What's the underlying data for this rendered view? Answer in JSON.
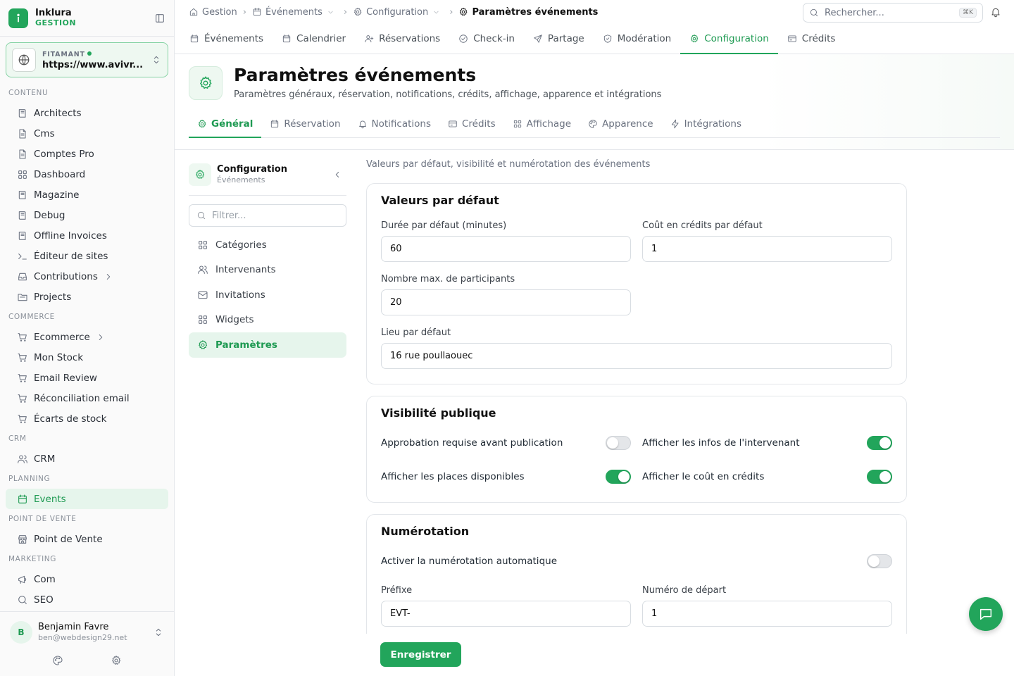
{
  "brand": {
    "name": "Inklura",
    "sub": "GESTION"
  },
  "site": {
    "label": "FITAMANT",
    "url": "https://www.avivr..."
  },
  "sidebar": {
    "sections": [
      {
        "title": "CONTENU",
        "items": [
          {
            "label": "Architects",
            "icon": "book-icon"
          },
          {
            "label": "Cms",
            "icon": "file-icon"
          },
          {
            "label": "Comptes Pro",
            "icon": "file-icon"
          },
          {
            "label": "Dashboard",
            "icon": "grid-icon"
          },
          {
            "label": "Magazine",
            "icon": "book-icon"
          },
          {
            "label": "Debug",
            "icon": "book-icon"
          },
          {
            "label": "Offline Invoices",
            "icon": "book-icon"
          },
          {
            "label": "Éditeur de sites",
            "icon": "terminal-icon"
          },
          {
            "label": "Contributions",
            "icon": "inbox-icon",
            "chevron": true
          },
          {
            "label": "Projects",
            "icon": "folder-icon"
          }
        ]
      },
      {
        "title": "COMMERCE",
        "items": [
          {
            "label": "Ecommerce",
            "icon": "cart-icon",
            "chevron": true
          },
          {
            "label": "Mon Stock",
            "icon": "cart-icon"
          },
          {
            "label": "Email Review",
            "icon": "cart-icon"
          },
          {
            "label": "Réconciliation email",
            "icon": "cart-icon"
          },
          {
            "label": "Écarts de stock",
            "icon": "cart-icon"
          }
        ]
      },
      {
        "title": "CRM",
        "items": [
          {
            "label": "CRM",
            "icon": "users-icon"
          }
        ]
      },
      {
        "title": "PLANNING",
        "items": [
          {
            "label": "Events",
            "icon": "calendar-icon",
            "active": true
          }
        ]
      },
      {
        "title": "POINT DE VENTE",
        "items": [
          {
            "label": "Point de Vente",
            "icon": "store-icon"
          }
        ]
      },
      {
        "title": "MARKETING",
        "items": [
          {
            "label": "Com",
            "icon": "megaphone-icon"
          },
          {
            "label": "SEO",
            "icon": "search-icon"
          }
        ]
      }
    ]
  },
  "user": {
    "initial": "B",
    "name": "Benjamin Favre",
    "email": "ben@webdesign29.net"
  },
  "breadcrumb": [
    {
      "label": "Gestion",
      "icon": "home-icon"
    },
    {
      "label": "Événements",
      "icon": "calendar-icon",
      "dropdown": true
    },
    {
      "label": "Configuration",
      "icon": "gear-icon",
      "dropdown": true
    },
    {
      "label": "Paramètres événements",
      "icon": "gear-icon",
      "current": true
    }
  ],
  "search": {
    "placeholder": "Rechercher...",
    "shortcut": "⌘K"
  },
  "module_tabs": [
    {
      "label": "Événements",
      "icon": "calendar-icon"
    },
    {
      "label": "Calendrier",
      "icon": "calendar-icon"
    },
    {
      "label": "Réservations",
      "icon": "user-plus-icon"
    },
    {
      "label": "Check-in",
      "icon": "check-circle-icon"
    },
    {
      "label": "Partage",
      "icon": "send-icon"
    },
    {
      "label": "Modération",
      "icon": "shield-icon"
    },
    {
      "label": "Configuration",
      "icon": "gear-icon",
      "active": true
    },
    {
      "label": "Crédits",
      "icon": "card-icon"
    }
  ],
  "page": {
    "title": "Paramètres événements",
    "subtitle": "Paramètres généraux, réservation, notifications, crédits, affichage, apparence et intégrations"
  },
  "settings_tabs": [
    {
      "label": "Général",
      "icon": "gear-icon",
      "active": true
    },
    {
      "label": "Réservation",
      "icon": "calendar-icon"
    },
    {
      "label": "Notifications",
      "icon": "bell-icon"
    },
    {
      "label": "Crédits",
      "icon": "card-icon"
    },
    {
      "label": "Affichage",
      "icon": "grid-icon"
    },
    {
      "label": "Apparence",
      "icon": "palette-icon"
    },
    {
      "label": "Intégrations",
      "icon": "zap-icon"
    }
  ],
  "subnav": {
    "title": "Configuration",
    "subtitle": "Événements",
    "filter_placeholder": "Filtrer...",
    "items": [
      {
        "label": "Catégories",
        "icon": "grid-icon"
      },
      {
        "label": "Intervenants",
        "icon": "users-icon"
      },
      {
        "label": "Invitations",
        "icon": "mail-icon"
      },
      {
        "label": "Widgets",
        "icon": "grid-icon"
      },
      {
        "label": "Paramètres",
        "icon": "gear-icon",
        "active": true
      }
    ]
  },
  "main": {
    "description": "Valeurs par défaut, visibilité et numérotation des événements",
    "defaults": {
      "title": "Valeurs par défaut",
      "duration_label": "Durée par défaut (minutes)",
      "duration_value": "60",
      "cost_label": "Coût en crédits par défaut",
      "cost_value": "1",
      "max_label": "Nombre max. de participants",
      "max_value": "20",
      "location_label": "Lieu par défaut",
      "location_value": "16 rue poullaouec"
    },
    "visibility": {
      "title": "Visibilité publique",
      "toggles": [
        {
          "label": "Approbation requise avant publication",
          "on": false
        },
        {
          "label": "Afficher les infos de l'intervenant",
          "on": true
        },
        {
          "label": "Afficher les places disponibles",
          "on": true
        },
        {
          "label": "Afficher le coût en crédits",
          "on": true
        }
      ]
    },
    "numbering": {
      "title": "Numérotation",
      "auto_label": "Activer la numérotation automatique",
      "auto_on": false,
      "prefix_label": "Préfixe",
      "prefix_value": "EVT-",
      "start_label": "Numéro de départ",
      "start_value": "1"
    },
    "save_label": "Enregistrer"
  },
  "colors": {
    "accent": "#22a55b",
    "accent_light": "#e6f5ec"
  }
}
